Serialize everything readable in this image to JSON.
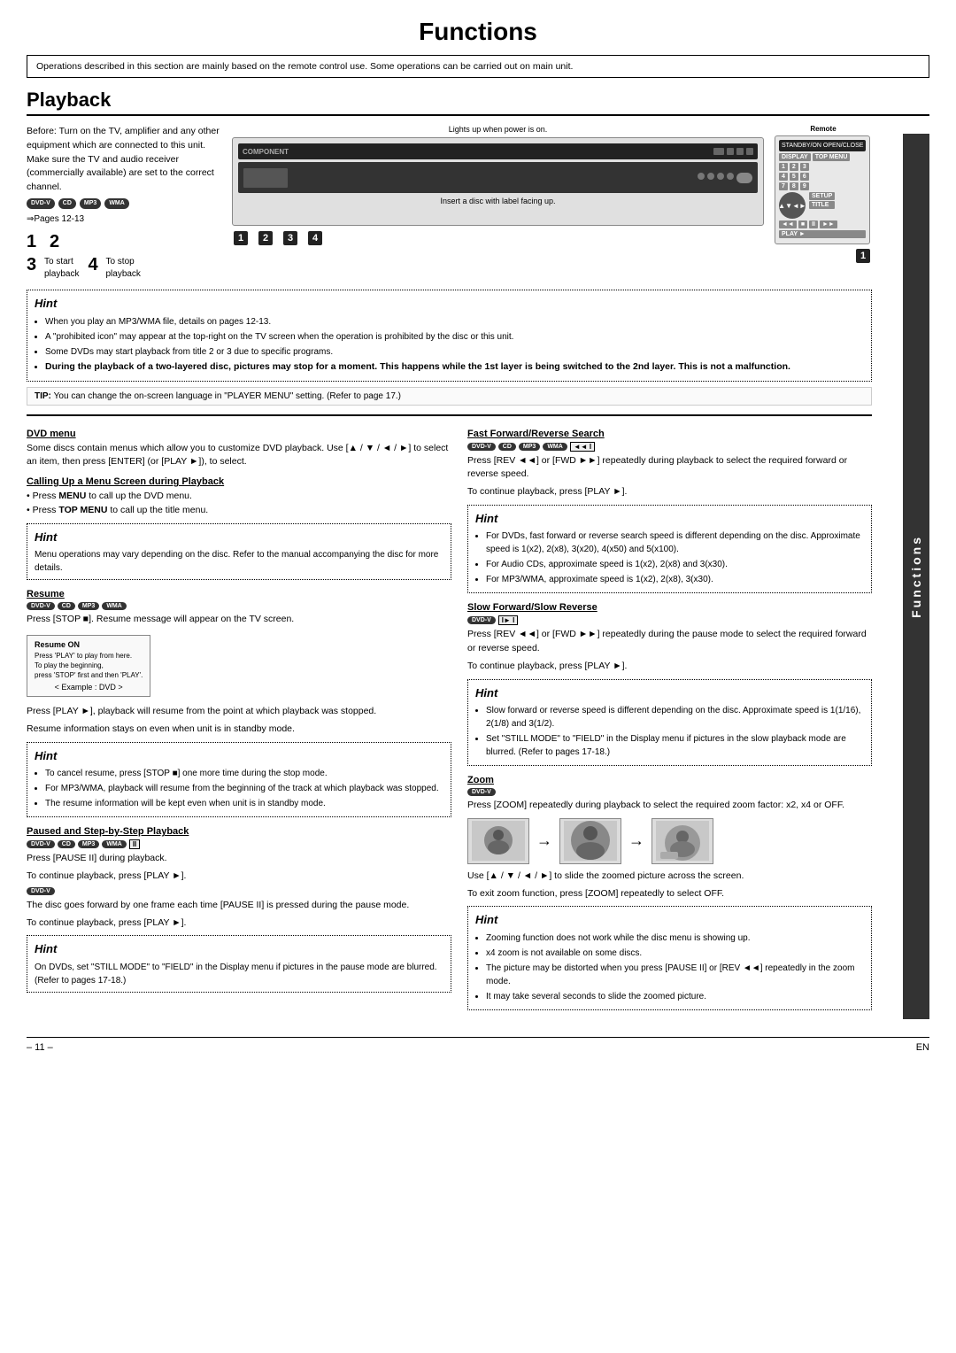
{
  "page": {
    "title": "Functions",
    "section": "Playback",
    "intro": "Operations described in this section are mainly based on the remote control use. Some operations can be carried out on main unit.",
    "footer_page": "– 11 –",
    "footer_lang": "EN"
  },
  "playback": {
    "before_text": "Before: Turn on the TV, amplifier and any other equipment which are connected to this unit. Make sure the TV and audio receiver (commercially available) are set to the correct channel.",
    "pages_ref": "⇒Pages 12-13",
    "lights_label": "Lights up when power is on.",
    "steps": [
      {
        "num": "1",
        "desc": ""
      },
      {
        "num": "2",
        "desc": "Insert a disc with label facing up."
      },
      {
        "num": "3",
        "desc": "To start playback"
      },
      {
        "num": "4",
        "desc": "To stop playback"
      }
    ],
    "hint_main": {
      "title": "Hint",
      "bullets": [
        "When you play an MP3/WMA file, details on pages 12-13.",
        "A \"prohibited icon\" may appear at the top-right on the TV screen when the operation is prohibited by the disc or this unit.",
        "Some DVDs may start playback from title 2 or 3 due to specific programs.",
        "During the playback of a two-layered disc, pictures may stop for a moment. This happens while the 1st layer is being switched to the 2nd layer. This is not a malfunction."
      ]
    },
    "tip": "You can change the on-screen language in \"PLAYER MENU\" setting. (Refer to page 17.)"
  },
  "dvd_menu": {
    "title": "DVD menu",
    "body": "Some discs contain menus which allow you to customize DVD playback. Use [▲ / ▼ / ◄ / ►] to select an item, then press [ENTER] (or [PLAY ►]), to select.",
    "calling_up": {
      "title": "Calling Up a Menu Screen during Playback",
      "bullets": [
        "Press MENU to call up the DVD menu.",
        "Press TOP MENU to call up the title menu."
      ]
    },
    "hint": {
      "title": "Hint",
      "text": "Menu operations may vary depending on the disc. Refer to the manual accompanying the disc for more details."
    }
  },
  "resume": {
    "title": "Resume",
    "disc_types": [
      "DVD-V",
      "CD",
      "MP3",
      "WMA"
    ],
    "body1": "Press [STOP ■]. Resume message will appear on the TV screen.",
    "body2": "Press [PLAY ►], playback will resume from the point at which playback was stopped.",
    "example": "< Example : DVD >",
    "resume_on_label": "Resume ON",
    "resume_instructions": "Press 'PLAY' to play from here.\nTo play the beginning,\npress 'STOP' first and then 'PLAY'.",
    "footnote": "Resume information stays on even when unit is in standby mode.",
    "hint": {
      "title": "Hint",
      "bullets": [
        "To cancel resume, press [STOP ■] one more time during the stop mode.",
        "For MP3/WMA, playback will resume from the beginning of the track at which playback was stopped.",
        "The resume information will be kept even when unit is in standby mode."
      ]
    }
  },
  "paused_step": {
    "title": "Paused and Step-by-Step Playback",
    "disc_types": [
      "DVD-V",
      "CD",
      "MP3",
      "WMA"
    ],
    "pause_badge": "II",
    "body1": "Press [PAUSE II] during playback.",
    "body2": "To continue playback, press [PLAY ►].",
    "dvd_only_body": "The disc goes forward by one frame each time [PAUSE II] is pressed during the pause mode.",
    "body3": "To continue playback, press [PLAY ►].",
    "hint": {
      "title": "Hint",
      "text": "On DVDs, set \"STILL MODE\" to \"FIELD\" in the Display menu if pictures in the pause mode are blurred. (Refer to pages 17-18.)"
    }
  },
  "fast_forward": {
    "title": "Fast Forward/Reverse Search",
    "disc_types": [
      "DVD-V",
      "CD",
      "MP3",
      "WMA"
    ],
    "badge": "◄◄ I",
    "body": "Press [REV ◄◄] or [FWD ►►] repeatedly during playback to select the required forward or reverse speed.",
    "continue": "To continue playback, press [PLAY ►].",
    "hint": {
      "title": "Hint",
      "bullets": [
        "For DVDs, fast forward or reverse search speed is different depending on the disc. Approximate speed is 1(x2), 2(x8), 3(x20), 4(x50) and 5(x100).",
        "For Audio CDs, approximate speed is 1(x2), 2(x8) and 3(x30).",
        "For MP3/WMA, approximate speed is 1(x2), 2(x8), 3(x30)."
      ]
    }
  },
  "slow_forward": {
    "title": "Slow Forward/Slow Reverse",
    "disc_types": [
      "DVD-V"
    ],
    "badge": "I► I",
    "body": "Press [REV ◄◄] or [FWD ►►] repeatedly during the pause mode to select the required forward or reverse speed.",
    "continue": "To continue playback, press [PLAY ►].",
    "hint": {
      "title": "Hint",
      "bullets": [
        "Slow forward or reverse speed is different depending on the disc. Approximate speed is 1(1/16), 2(1/8) and 3(1/2).",
        "Set \"STILL MODE\" to \"FIELD\" in the Display menu if pictures in the slow playback mode are blurred. (Refer to pages 17-18.)"
      ]
    }
  },
  "zoom": {
    "title": "Zoom",
    "disc_types": [
      "DVD-V"
    ],
    "body": "Press [ZOOM] repeatedly during playback to select the required zoom factor: x2, x4 or OFF.",
    "slide_text": "Use [▲ / ▼ / ◄ / ►] to slide the zoomed picture across the screen.",
    "exit_text": "To exit zoom function, press [ZOOM] repeatedly to select OFF.",
    "hint": {
      "title": "Hint",
      "bullets": [
        "Zooming function does not work while the disc menu is showing up.",
        "x4 zoom is not available on some discs.",
        "The picture may be distorted when you press [PAUSE II] or [REV ◄◄] repeatedly in the zoom mode.",
        "It may take several seconds to slide the zoomed picture."
      ]
    }
  },
  "functions_sidebar_label": "Functions"
}
